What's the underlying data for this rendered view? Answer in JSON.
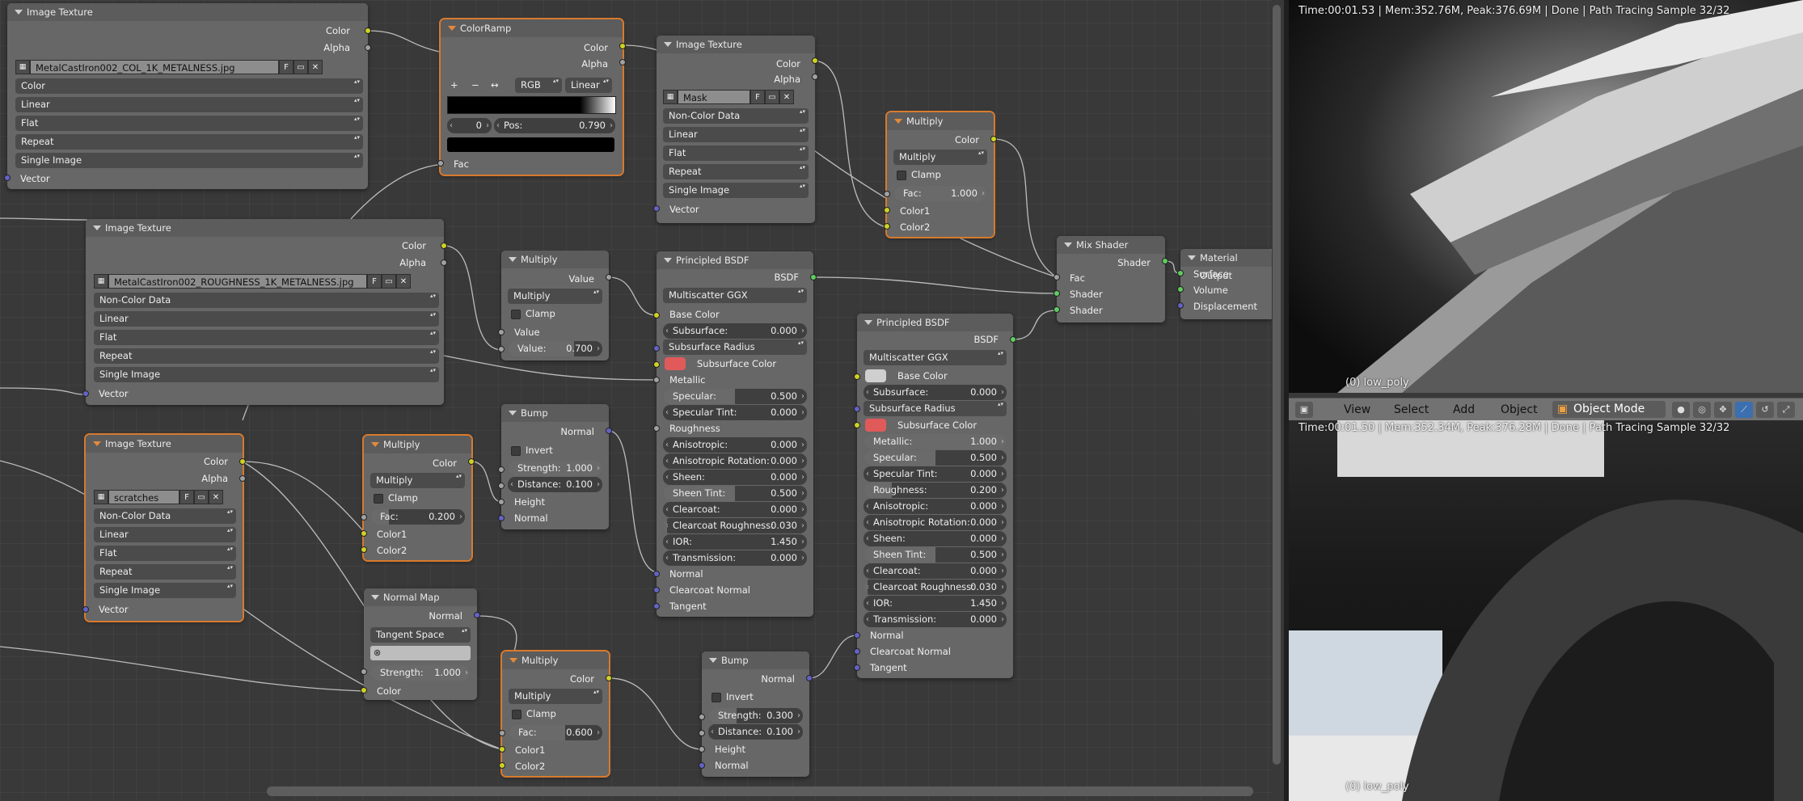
{
  "nodes": {
    "tex1": {
      "title": "Image Texture",
      "out_color": "Color",
      "out_alpha": "Alpha",
      "file": "MetalCastIron002_COL_1K_METALNESS.jpg",
      "file_flag": "F",
      "color_space": "Color",
      "interp": "Linear",
      "projection": "Flat",
      "extension": "Repeat",
      "source": "Single Image",
      "in_vector": "Vector"
    },
    "ramp": {
      "title": "ColorRamp",
      "out_color": "Color",
      "out_alpha": "Alpha",
      "btn_add": "+",
      "btn_remove": "−",
      "btn_flip": "↔",
      "color_mode": "RGB",
      "interp": "Linear",
      "stop_index": "0",
      "pos_label": "Pos:",
      "pos_value": "0.790",
      "in_fac": "Fac"
    },
    "tex2": {
      "title": "Image Texture",
      "out_color": "Color",
      "out_alpha": "Alpha",
      "file": "Mask",
      "file_flag": "F",
      "color_space": "Non-Color Data",
      "interp": "Linear",
      "projection": "Flat",
      "extension": "Repeat",
      "source": "Single Image",
      "in_vector": "Vector"
    },
    "mult1": {
      "title": "Multiply",
      "out_color": "Color",
      "mode": "Multiply",
      "clamp": "Clamp",
      "fac_label": "Fac:",
      "fac_value": "1.000",
      "in_color1": "Color1",
      "in_color2": "Color2"
    },
    "tex3": {
      "title": "Image Texture",
      "out_color": "Color",
      "out_alpha": "Alpha",
      "file": "MetalCastIron002_ROUGHNESS_1K_METALNESS.jpg",
      "file_flag": "F",
      "color_space": "Non-Color Data",
      "interp": "Linear",
      "projection": "Flat",
      "extension": "Repeat",
      "source": "Single Image",
      "in_vector": "Vector"
    },
    "mathmul": {
      "title": "Multiply",
      "out_value": "Value",
      "mode": "Multiply",
      "clamp": "Clamp",
      "in_value": "Value",
      "value_label": "Value:",
      "value_value": "0.700"
    },
    "bsdf1": {
      "title": "Principled BSDF",
      "out_bsdf": "BSDF",
      "dist": "Multiscatter GGX",
      "base_color": "Base Color",
      "subsurface_label": "Subsurface:",
      "subsurface_value": "0.000",
      "ss_radius": "Subsurface Radius",
      "ss_color": "Subsurface Color",
      "metallic": "Metallic",
      "specular_label": "Specular:",
      "specular_value": "0.500",
      "spec_tint_label": "Specular Tint:",
      "spec_tint_value": "0.000",
      "roughness": "Roughness",
      "aniso_label": "Anisotropic:",
      "aniso_value": "0.000",
      "aniso_rot_label": "Anisotropic Rotation:",
      "aniso_rot_value": "0.000",
      "sheen_label": "Sheen:",
      "sheen_value": "0.000",
      "sheen_tint_label": "Sheen Tint:",
      "sheen_tint_value": "0.500",
      "clearcoat_label": "Clearcoat:",
      "clearcoat_value": "0.000",
      "cc_rough_label": "Clearcoat Roughness:",
      "cc_rough_value": "0.030",
      "ior_label": "IOR:",
      "ior_value": "1.450",
      "trans_label": "Transmission:",
      "trans_value": "0.000",
      "normal": "Normal",
      "cc_normal": "Clearcoat Normal",
      "tangent": "Tangent"
    },
    "bsdf2": {
      "title": "Principled BSDF",
      "out_bsdf": "BSDF",
      "dist": "Multiscatter GGX",
      "base_color": "Base Color",
      "subsurface_label": "Subsurface:",
      "subsurface_value": "0.000",
      "ss_radius": "Subsurface Radius",
      "ss_color": "Subsurface Color",
      "metallic_label": "Metallic:",
      "metallic_value": "1.000",
      "specular_label": "Specular:",
      "specular_value": "0.500",
      "spec_tint_label": "Specular Tint:",
      "spec_tint_value": "0.000",
      "rough_label": "Roughness:",
      "rough_value": "0.200",
      "aniso_label": "Anisotropic:",
      "aniso_value": "0.000",
      "aniso_rot_label": "Anisotropic Rotation:",
      "aniso_rot_value": "0.000",
      "sheen_label": "Sheen:",
      "sheen_value": "0.000",
      "sheen_tint_label": "Sheen Tint:",
      "sheen_tint_value": "0.500",
      "clearcoat_label": "Clearcoat:",
      "clearcoat_value": "0.000",
      "cc_rough_label": "Clearcoat Roughness:",
      "cc_rough_value": "0.030",
      "ior_label": "IOR:",
      "ior_value": "1.450",
      "trans_label": "Transmission:",
      "trans_value": "0.000",
      "normal": "Normal",
      "cc_normal": "Clearcoat Normal",
      "tangent": "Tangent"
    },
    "mix": {
      "title": "Mix Shader",
      "out_shader": "Shader",
      "in_fac": "Fac",
      "in_shader1": "Shader",
      "in_shader2": "Shader"
    },
    "matout": {
      "title": "Material Output",
      "in_surface": "Surface",
      "in_volume": "Volume",
      "in_displacement": "Displacement"
    },
    "tex4": {
      "title": "Image Texture",
      "out_color": "Color",
      "out_alpha": "Alpha",
      "file": "scratches",
      "file_flag": "F",
      "color_space": "Non-Color Data",
      "interp": "Linear",
      "projection": "Flat",
      "extension": "Repeat",
      "source": "Single Image",
      "in_vector": "Vector"
    },
    "mult2": {
      "title": "Multiply",
      "out_color": "Color",
      "mode": "Multiply",
      "clamp": "Clamp",
      "fac_label": "Fac:",
      "fac_value": "0.200",
      "in_color1": "Color1",
      "in_color2": "Color2"
    },
    "bump1": {
      "title": "Bump",
      "out_normal": "Normal",
      "invert": "Invert",
      "strength_label": "Strength:",
      "strength_value": "1.000",
      "distance_label": "Distance:",
      "distance_value": "0.100",
      "in_height": "Height",
      "in_normal": "Normal"
    },
    "nmap": {
      "title": "Normal Map",
      "out_normal": "Normal",
      "space": "Tangent Space",
      "strength_label": "Strength:",
      "strength_value": "1.000",
      "in_color": "Color"
    },
    "mult3": {
      "title": "Multiply",
      "out_color": "Color",
      "mode": "Multiply",
      "clamp": "Clamp",
      "fac_label": "Fac:",
      "fac_value": "0.600",
      "in_color1": "Color1",
      "in_color2": "Color2"
    },
    "bump2": {
      "title": "Bump",
      "out_normal": "Normal",
      "invert": "Invert",
      "strength_label": "Strength:",
      "strength_value": "0.300",
      "distance_label": "Distance:",
      "distance_value": "0.100",
      "in_height": "Height",
      "in_normal": "Normal"
    }
  },
  "viewport_top": {
    "stats": "Time:00:01.53 | Mem:352.76M, Peak:376.69M | Done | Path Tracing Sample 32/32",
    "object_name": "(0) low_poly"
  },
  "viewport_header": {
    "view": "View",
    "select": "Select",
    "add": "Add",
    "object": "Object",
    "mode": "Object Mode"
  },
  "viewport_bottom": {
    "stats": "Time:00:01.50 | Mem:352.34M, Peak:376.28M | Done | Path Tracing Sample 32/32",
    "object_name": "(0) low_poly"
  },
  "colors": {
    "socket_color": "#cfd124",
    "socket_value": "#a1a1a1",
    "socket_vector": "#6363c6",
    "socket_shader": "#5fcc5f",
    "selected_outline": "#d87a2e",
    "subsurface_color": "#e05a5a"
  },
  "icons": [
    "image-icon",
    "folder-icon",
    "close-icon",
    "dropdown-arrows-icon",
    "node-collapse-icon",
    "cube-icon",
    "sphere-icon"
  ]
}
